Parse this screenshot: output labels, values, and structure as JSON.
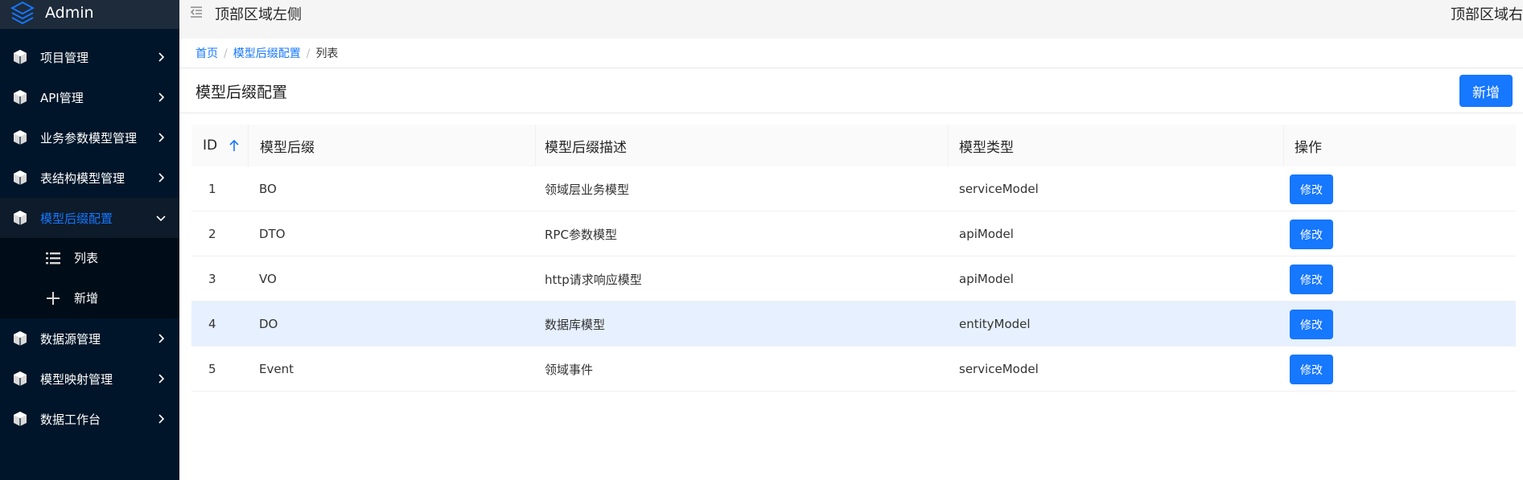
{
  "brand": {
    "name": "Admin"
  },
  "header": {
    "left_text": "顶部区域左侧",
    "right_text": "顶部区域右侧"
  },
  "sidebar": {
    "items": [
      {
        "label": "项目管理"
      },
      {
        "label": "API管理"
      },
      {
        "label": "业务参数模型管理"
      },
      {
        "label": "表结构模型管理"
      },
      {
        "label": "模型后缀配置",
        "expanded": true
      },
      {
        "label": "数据源管理"
      },
      {
        "label": "模型映射管理"
      },
      {
        "label": "数据工作台"
      }
    ],
    "submenu": [
      {
        "label": "列表",
        "icon": "list-icon"
      },
      {
        "label": "新增",
        "icon": "plus-icon"
      }
    ]
  },
  "breadcrumb": {
    "home": "首页",
    "section": "模型后缀配置",
    "current": "列表",
    "separator": "/"
  },
  "page": {
    "title": "模型后缀配置",
    "add_label": "新增"
  },
  "table": {
    "columns": [
      "ID",
      "模型后缀",
      "模型后缀描述",
      "模型类型",
      "操作"
    ],
    "edit_label": "修改",
    "rows": [
      {
        "id": "1",
        "suffix": "BO",
        "desc": "领域层业务模型",
        "type": "serviceModel"
      },
      {
        "id": "2",
        "suffix": "DTO",
        "desc": "RPC参数模型",
        "type": "apiModel"
      },
      {
        "id": "3",
        "suffix": "VO",
        "desc": "http请求响应模型",
        "type": "apiModel"
      },
      {
        "id": "4",
        "suffix": "DO",
        "desc": "数据库模型",
        "type": "entityModel"
      },
      {
        "id": "5",
        "suffix": "Event",
        "desc": "领域事件",
        "type": "serviceModel"
      }
    ]
  },
  "colors": {
    "sidebar_bg": "#001529",
    "accent": "#1677ff",
    "row_highlight": "#e6f0ff"
  }
}
